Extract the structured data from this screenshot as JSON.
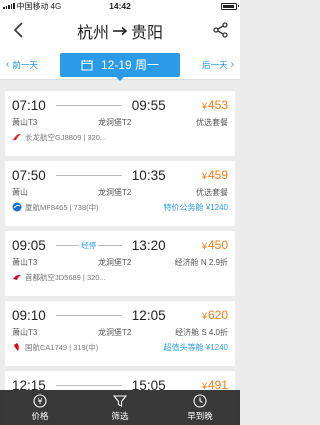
{
  "status": {
    "carrier": "中国移动",
    "network": "4G",
    "time": "14:42"
  },
  "header": {
    "origin": "杭州",
    "destination": "贵阳"
  },
  "date_bar": {
    "prev_label": "前一天",
    "date_label": "12-19 周一",
    "next_label": "后一天"
  },
  "flights": [
    {
      "dep_time": "07:10",
      "arr_time": "09:55",
      "stop": "",
      "price": "453",
      "dep_airport": "萧山T3",
      "arr_airport": "龙洞堡T2",
      "tag": "优选套餐",
      "airline_info": "长龙航空GJ8809 | 320...",
      "badge": "",
      "logo_color": "#d9232d"
    },
    {
      "dep_time": "07:50",
      "arr_time": "10:35",
      "stop": "",
      "price": "459",
      "dep_airport": "萧山",
      "arr_airport": "龙洞堡T2",
      "tag": "优选套餐",
      "airline_info": "厦航MF8465 | 738(中)",
      "badge": "特价公务舱 ¥1240",
      "logo_color": "#1b6fc2"
    },
    {
      "dep_time": "09:05",
      "arr_time": "13:20",
      "stop": "经停",
      "price": "450",
      "dep_airport": "萧山T3",
      "arr_airport": "龙洞堡T2",
      "tag": "经济舱 N 2.9折",
      "airline_info": "首都航空JD5689 | 320...",
      "badge": "",
      "logo_color": "#c8102e"
    },
    {
      "dep_time": "09:10",
      "arr_time": "12:05",
      "stop": "",
      "price": "620",
      "dep_airport": "萧山T3",
      "arr_airport": "龙洞堡T2",
      "tag": "经济舱 S 4.0折",
      "airline_info": "国航CA1749 | 319(中)",
      "badge": "超值头等舱 ¥1240",
      "logo_color": "#e60012"
    },
    {
      "dep_time": "12:15",
      "arr_time": "15:05",
      "stop": "",
      "price": "491",
      "dep_airport": "",
      "arr_airport": "",
      "tag": "",
      "airline_info": "",
      "badge": "",
      "logo_color": "#d9232d"
    }
  ],
  "toolbar": {
    "price_label": "价格",
    "filter_label": "筛选",
    "sort_label": "早到晚"
  },
  "colors": {
    "accent": "#2b9be8",
    "price": "#f27d18"
  }
}
